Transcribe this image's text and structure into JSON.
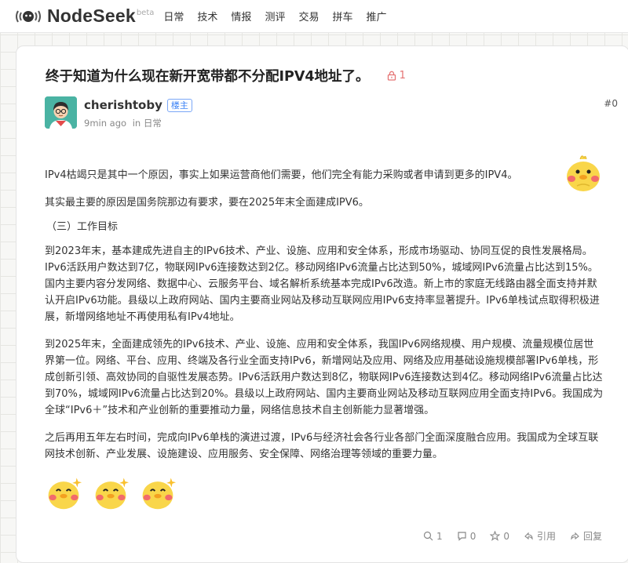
{
  "header": {
    "logo_text": "NodeSeek",
    "beta": "beta",
    "nav": [
      "日常",
      "技术",
      "情报",
      "测评",
      "交易",
      "拼车",
      "推广"
    ]
  },
  "post": {
    "title": "终于知道为什么现在新开宽带都不分配IPV4地址了。",
    "lock_count": "1",
    "author": "cherishtoby",
    "op_badge": "楼主",
    "time": "9min ago",
    "in": "in",
    "category": "日常",
    "floor": "#0",
    "paragraphs": [
      "IPv4枯竭只是其中一个原因，事实上如果运营商他们需要，他们完全有能力采购或者申请到更多的IPV4。",
      "其实最主要的原因是国务院那边有要求，要在2025年末全面建成IPV6。",
      "（三）工作目标",
      "到2023年末，基本建成先进自主的IPv6技术、产业、设施、应用和安全体系，形成市场驱动、协同互促的良性发展格局。IPv6活跃用户数达到7亿，物联网IPv6连接数达到2亿。移动网络IPv6流量占比达到50%，城域网IPv6流量占比达到15%。国内主要内容分发网络、数据中心、云服务平台、域名解析系统基本完成IPv6改造。新上市的家庭无线路由器全面支持并默认开启IPv6功能。县级以上政府网站、国内主要商业网站及移动互联网应用IPv6支持率显著提升。IPv6单栈试点取得积极进展，新增网络地址不再使用私有IPv4地址。",
      "到2025年末，全面建成领先的IPv6技术、产业、设施、应用和安全体系，我国IPv6网络规模、用户规模、流量规模位居世界第一位。网络、平台、应用、终端及各行业全面支持IPv6，新增网站及应用、网络及应用基础设施规模部署IPv6单栈，形成创新引领、高效协同的自驱性发展态势。IPv6活跃用户数达到8亿，物联网IPv6连接数达到4亿。移动网络IPv6流量占比达到70%，城域网IPv6流量占比达到20%。县级以上政府网站、国内主要商业网站及移动互联网应用全面支持IPv6。我国成为全球“IPv6＋”技术和产业创新的重要推动力量，网络信息技术自主创新能力显著增强。",
      "之后再用五年左右时间，完成向IPv6单栈的演进过渡，IPv6与经济社会各行业各部门全面深度融合应用。我国成为全球互联网技术创新、产业发展、设施建设、应用服务、安全保障、网络治理等领域的重要力量。"
    ],
    "footer": {
      "likes": "1",
      "comments": "0",
      "stars": "0",
      "quote_label": "引用",
      "reply_label": "回复"
    }
  },
  "colors": {
    "accent": "#3b82f6",
    "lock": "#e57373",
    "duck_yellow": "#f9d64a",
    "duck_cheek": "#f26b6b"
  }
}
